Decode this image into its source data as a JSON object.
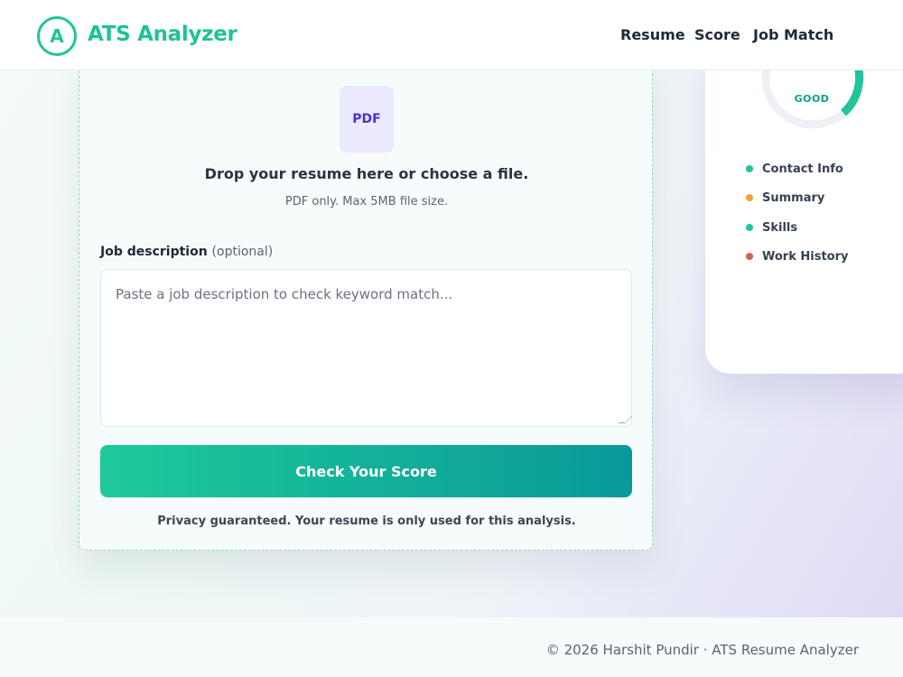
{
  "brand": {
    "logo_letter": "A",
    "name": "ATS Analyzer",
    "color": "#1fc296"
  },
  "nav": {
    "items": [
      "Resume",
      "Score",
      "Job Match"
    ]
  },
  "upload": {
    "icon_label": "PDF",
    "title": "Drop your resume here or choose a file.",
    "subtitle": "PDF only. Max 5MB file size."
  },
  "job_description": {
    "label": "Job description",
    "optional": "(optional)",
    "placeholder": "Paste a job description to check keyword match..."
  },
  "cta": {
    "label": "Check Your Score"
  },
  "privacy_note": "Privacy guaranteed. Your resume is only used for this analysis.",
  "preview": {
    "gauge_label": "GOOD",
    "checks": [
      {
        "label": "Contact Info",
        "status_color": "#22c49a"
      },
      {
        "label": "Summary",
        "status_color": "#f0a23a"
      },
      {
        "label": "Skills",
        "status_color": "#22c49a"
      },
      {
        "label": "Work History",
        "status_color": "#e05a5a"
      }
    ]
  },
  "footer": {
    "text": "© 2026 Harshit Pundir · ATS Resume Analyzer"
  },
  "colors": {
    "accent": "#22c49a",
    "accent_dark": "#089a9a",
    "pdf_badge": "#4f2fd4"
  }
}
